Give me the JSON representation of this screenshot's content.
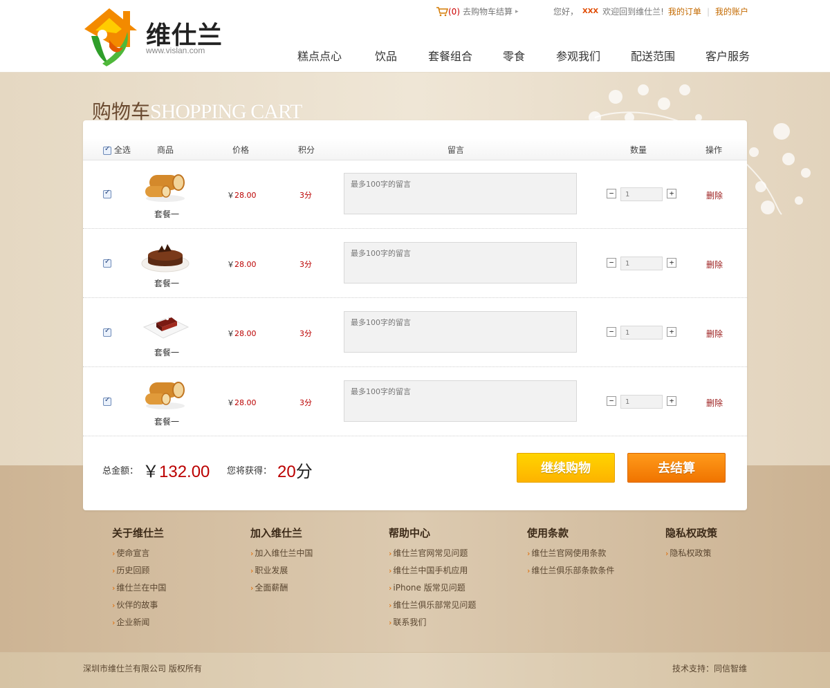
{
  "brand": {
    "name": "维仕兰",
    "url": "www.vislan.com"
  },
  "topbar": {
    "cart_count": "(0)",
    "cart_label": "去购物车结算",
    "greeting_prefix": "您好，",
    "username": "XXX",
    "greeting_suffix": "欢迎回到维仕兰!",
    "my_orders": "我的订单",
    "my_account": "我的账户"
  },
  "nav": [
    {
      "label": "糕点点心"
    },
    {
      "label": "饮品"
    },
    {
      "label": "套餐组合"
    },
    {
      "label": "零食"
    },
    {
      "label": "参观我们"
    },
    {
      "label": "配送范围"
    },
    {
      "label": "客户服务"
    }
  ],
  "page_title": {
    "zh": "购物车",
    "en": "SHOPPING CART"
  },
  "table_header": {
    "select_all": "全选",
    "product": "商品",
    "price": "价格",
    "points": "积分",
    "note": "留言",
    "quantity": "数量",
    "action": "操作"
  },
  "items": [
    {
      "image": "swiss-roll",
      "name": "套餐一",
      "currency": "￥",
      "price": "28.00",
      "points": "3分",
      "note_placeholder": "最多100字的留言",
      "quantity": "1",
      "delete": "删除",
      "checked": true
    },
    {
      "image": "chocolate-cake",
      "name": "套餐一",
      "currency": "￥",
      "price": "28.00",
      "points": "3分",
      "note_placeholder": "最多100字的留言",
      "quantity": "1",
      "delete": "删除",
      "checked": true
    },
    {
      "image": "cake-slice",
      "name": "套餐一",
      "currency": "￥",
      "price": "28.00",
      "points": "3分",
      "note_placeholder": "最多100字的留言",
      "quantity": "1",
      "delete": "删除",
      "checked": true
    },
    {
      "image": "swiss-roll",
      "name": "套餐一",
      "currency": "￥",
      "price": "28.00",
      "points": "3分",
      "note_placeholder": "最多100字的留言",
      "quantity": "1",
      "delete": "删除",
      "checked": true
    }
  ],
  "summary": {
    "total_label": "总金额：",
    "currency": "￥",
    "total": "132.00",
    "earn_label": "您将获得：",
    "earn_points": "20",
    "earn_unit": "分"
  },
  "buttons": {
    "continue": "继续购物",
    "checkout": "去结算"
  },
  "footer_columns": [
    {
      "title": "关于维仕兰",
      "links": [
        "使命宣言",
        "历史回顾",
        "维仕兰在中国",
        "伙伴的故事",
        "企业新闻"
      ]
    },
    {
      "title": "加入维仕兰",
      "links": [
        "加入维仕兰中国",
        "职业发展",
        "全面薪酬"
      ]
    },
    {
      "title": "帮助中心",
      "links": [
        "维仕兰官网常见问题",
        "维仕兰中国手机应用",
        "iPhone 版常见问题",
        "维仕兰俱乐部常见问题",
        "联系我们"
      ]
    },
    {
      "title": "使用条款",
      "links": [
        "维仕兰官网使用条款",
        "维仕兰俱乐部条款条件"
      ]
    },
    {
      "title": "隐私权政策",
      "links": [
        "隐私权政策"
      ]
    }
  ],
  "footer": {
    "copyright": "深圳市维仕兰有限公司  版权所有",
    "support": "技术支持：同信智维"
  },
  "colors": {
    "accent_orange": "#f07400",
    "accent_yellow": "#fdb300",
    "price_red": "#b00000",
    "bg_beige": "#efe6d6"
  }
}
